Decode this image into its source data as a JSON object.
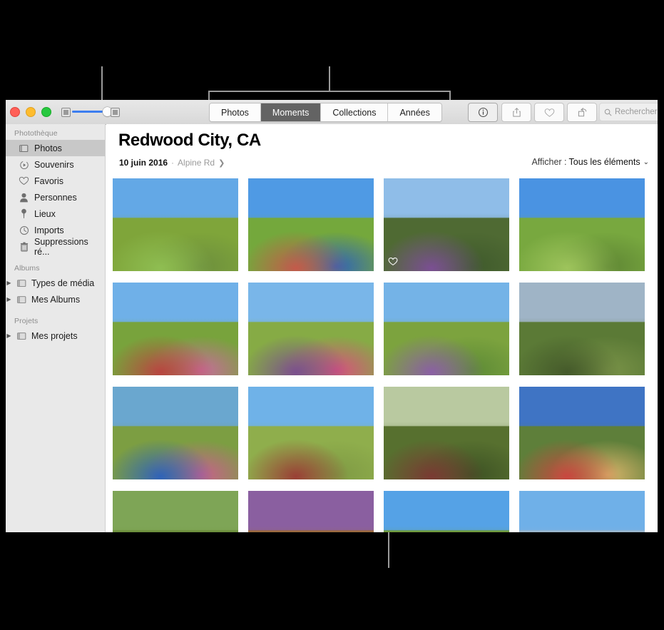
{
  "window": {
    "traffic_lights": [
      "close",
      "minimize",
      "zoom"
    ],
    "zoom_slider": {
      "left_icon": "small-thumbnails-icon",
      "right_icon": "large-thumbnails-icon",
      "value_percent": 80
    }
  },
  "toolbar": {
    "segments": [
      {
        "label": "Photos",
        "selected": false
      },
      {
        "label": "Moments",
        "selected": true
      },
      {
        "label": "Collections",
        "selected": false
      },
      {
        "label": "Années",
        "selected": false
      }
    ],
    "buttons": [
      {
        "name": "info-button",
        "icon": "info-icon",
        "active": true
      },
      {
        "name": "share-button",
        "icon": "share-icon",
        "active": false
      },
      {
        "name": "favorite-button",
        "icon": "heart-icon",
        "active": false
      },
      {
        "name": "rotate-button",
        "icon": "rotate-icon",
        "active": false
      }
    ],
    "search": {
      "placeholder": "Rechercher",
      "value": "",
      "icon": "search-icon"
    }
  },
  "sidebar": {
    "sections": [
      {
        "title": "Photothèque",
        "items": [
          {
            "label": "Photos",
            "icon": "photos-icon",
            "selected": true
          },
          {
            "label": "Souvenirs",
            "icon": "memories-icon",
            "selected": false
          },
          {
            "label": "Favoris",
            "icon": "heart-icon",
            "selected": false
          },
          {
            "label": "Personnes",
            "icon": "person-icon",
            "selected": false
          },
          {
            "label": "Lieux",
            "icon": "pin-icon",
            "selected": false
          },
          {
            "label": "Imports",
            "icon": "clock-icon",
            "selected": false
          },
          {
            "label": "Suppressions ré...",
            "icon": "trash-icon",
            "selected": false
          }
        ]
      },
      {
        "title": "Albums",
        "items": [
          {
            "label": "Types de média",
            "icon": "album-icon",
            "disclosure": "▶"
          },
          {
            "label": "Mes Albums",
            "icon": "album-icon",
            "disclosure": "▶"
          }
        ]
      },
      {
        "title": "Projets",
        "items": [
          {
            "label": "Mes projets",
            "icon": "album-icon",
            "disclosure": "▶"
          }
        ]
      }
    ]
  },
  "main": {
    "title": "Redwood City, CA",
    "date": "10 juin 2016",
    "separator": "·",
    "place": "Alpine Rd",
    "place_chevron": "❯",
    "show_menu": {
      "label": "Afficher :",
      "value": "Tous les éléments",
      "chevron": "⌄"
    },
    "photos": [
      {
        "alt": "trail-through-tall-grass",
        "favorite": false,
        "sky": "#63a8e6",
        "land": "#7fa53a",
        "v1": "#8fbe52",
        "v2": "#6d8f3d"
      },
      {
        "alt": "couple-embracing-on-hillside",
        "favorite": false,
        "sky": "#4f9ae4",
        "land": "#74a83c",
        "v1": "#c45a4a",
        "v2": "#2f63b8"
      },
      {
        "alt": "woman-with-backpack-on-ridge",
        "favorite": true,
        "sky": "#8fbde8",
        "land": "#4f6a33",
        "v1": "#7b4f93",
        "v2": "#3f5a2c"
      },
      {
        "alt": "hikers-walking-down-hill",
        "favorite": false,
        "sky": "#4a93e2",
        "land": "#78a83f",
        "v1": "#9ec45c",
        "v2": "#5f8634"
      },
      {
        "alt": "family-hiking-from-behind",
        "favorite": false,
        "sky": "#6fb0e8",
        "land": "#78a33c",
        "v1": "#b8453f",
        "v2": "#c86b9c"
      },
      {
        "alt": "two-girls-with-backpacks",
        "favorite": false,
        "sky": "#79b6e9",
        "land": "#86ab45",
        "v1": "#7a4f8e",
        "v2": "#d8507e"
      },
      {
        "alt": "girl-in-purple-jacket",
        "favorite": false,
        "sky": "#74b3e7",
        "land": "#7ca33e",
        "v1": "#8b5fa5",
        "v2": "#5d8a36"
      },
      {
        "alt": "couple-on-path-at-dusk",
        "favorite": false,
        "sky": "#9fb4c6",
        "land": "#5b7a36",
        "v1": "#44592a",
        "v2": "#7a9348"
      },
      {
        "alt": "man-and-children-sitting-in-grass",
        "favorite": false,
        "sky": "#6aa7cf",
        "land": "#7c9e42",
        "v1": "#2f63b8",
        "v2": "#c95f8e"
      },
      {
        "alt": "boy-with-curly-hair-on-hillside",
        "favorite": false,
        "sky": "#6fb2e8",
        "land": "#8fae4c",
        "v1": "#9a3f36",
        "v2": "#7f9a44"
      },
      {
        "alt": "girls-in-tall-grass-backlit",
        "favorite": false,
        "sky": "#b9c9a0",
        "land": "#57702f",
        "v1": "#7a3a33",
        "v2": "#3d5224"
      },
      {
        "alt": "two-children-close-up",
        "favorite": false,
        "sky": "#3f74c4",
        "land": "#5e7f3a",
        "v1": "#c9463f",
        "v2": "#d9b46a"
      },
      {
        "alt": "smiling-man-in-grass",
        "favorite": false,
        "sky": "#7ea556",
        "land": "#6d8f3d",
        "v1": "#2f63b8",
        "v2": "#9a7a4a"
      },
      {
        "alt": "child-with-curly-hair-close-up",
        "favorite": false,
        "sky": "#8a5fa0",
        "land": "#9a6a3f",
        "v1": "#2f63b8",
        "v2": "#c2793f"
      },
      {
        "alt": "trees-on-green-hilltop",
        "favorite": false,
        "sky": "#55a2e6",
        "land": "#6f9a3e",
        "v1": "#3d6b2c",
        "v2": "#8fb352"
      },
      {
        "alt": "man-and-child-against-sky",
        "favorite": false,
        "sky": "#6fb0e8",
        "land": "#9ab6cc",
        "v1": "#c9b83f",
        "v2": "#7a5a3a"
      }
    ]
  }
}
